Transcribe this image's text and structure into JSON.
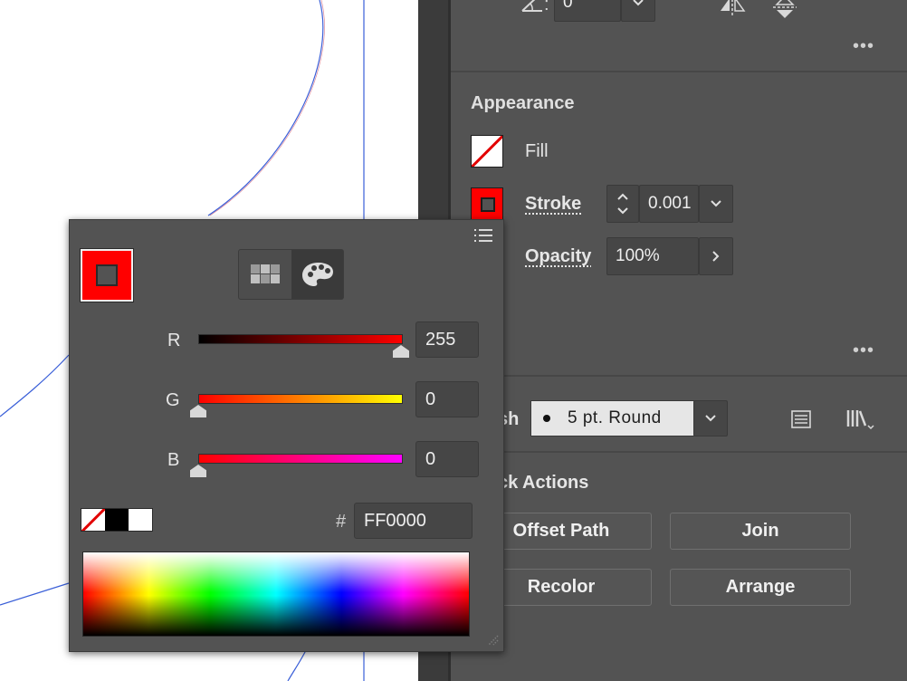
{
  "transform": {
    "angle_value": "0°"
  },
  "appearance": {
    "section_title": "Appearance",
    "fill_label": "Fill",
    "stroke_label": "Stroke",
    "stroke_value": "0.001",
    "opacity_label": "Opacity",
    "opacity_value": "100%"
  },
  "brush": {
    "label_partial": "sh",
    "value": "5 pt. Round"
  },
  "quick_actions": {
    "title_partial": "ck Actions",
    "buttons": [
      "Offset Path",
      "Join",
      "Recolor",
      "Arrange"
    ]
  },
  "color_picker": {
    "stroke_color": "#ff0000",
    "channels": [
      {
        "label": "R",
        "value": "255",
        "level": 1.0
      },
      {
        "label": "G",
        "value": "0",
        "level": 0.0
      },
      {
        "label": "B",
        "value": "0",
        "level": 0.0
      }
    ],
    "hex_label": "#",
    "hex_value": "FF0000"
  },
  "icons": [
    "angle-icon",
    "chevron-down-icon",
    "flip-horizontal-icon",
    "flip-vertical-icon",
    "more-icon",
    "menu-icon",
    "swatches-icon",
    "palette-icon",
    "brush-panel-icon",
    "brush-library-icon",
    "stepper-icon",
    "chevron-right-icon"
  ]
}
